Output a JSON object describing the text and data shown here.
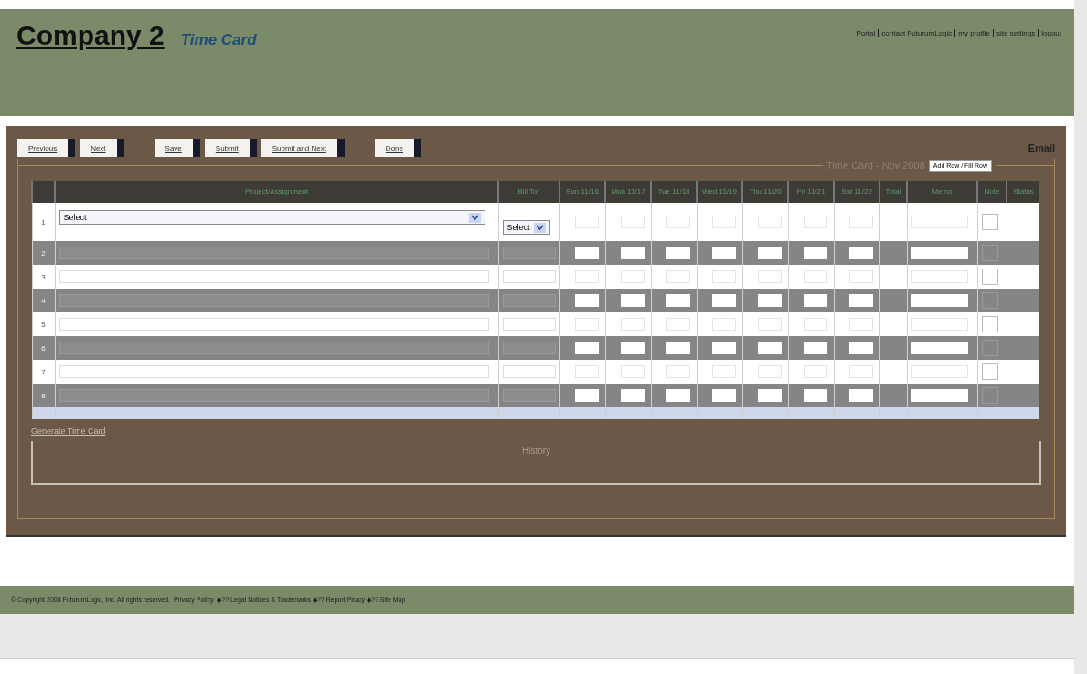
{
  "header": {
    "company": "Company 2",
    "subtitle": "Time Card",
    "links": [
      "Portal",
      "contact FuturumLogic",
      "my profile",
      "site settings",
      "logout"
    ]
  },
  "toolbar": {
    "buttons": [
      "Previous",
      "Next",
      "Save",
      "Submit",
      "Submit and Next",
      "Done"
    ],
    "email": "Email"
  },
  "timecard": {
    "legend": "Time Card - Nov 2008",
    "add_row": "Add Row / Fill Row",
    "columns": [
      "",
      "Project/Assignment",
      "Bill To*",
      "Sun 11/16",
      "Mon 11/17",
      "Tue 11/18",
      "Wed 11/19",
      "Thu 11/20",
      "Fri 11/21",
      "Sat 11/22",
      "Total",
      "Memo",
      "Note",
      "Status"
    ],
    "rows": [
      {
        "number": "1",
        "kind": "select",
        "shaded": false,
        "project": "Select",
        "bill_to": "Select"
      },
      {
        "number": "2",
        "kind": "blank",
        "shaded": true
      },
      {
        "number": "3",
        "kind": "blank",
        "shaded": false
      },
      {
        "number": "4",
        "kind": "blank",
        "shaded": true
      },
      {
        "number": "5",
        "kind": "blank",
        "shaded": false
      },
      {
        "number": "6",
        "kind": "blank",
        "shaded": true
      },
      {
        "number": "7",
        "kind": "blank",
        "shaded": false
      },
      {
        "number": "8",
        "kind": "blank",
        "shaded": true
      }
    ]
  },
  "generate_link": "Generate Time Card",
  "history": "History",
  "footer": "© Copyright 2008 FuturumLogic, Inc. All rights reserved.  Privacy Policy  ◆?? Legal Notices & Trademarks ◆?? Report Piracy ◆?? Site Map"
}
